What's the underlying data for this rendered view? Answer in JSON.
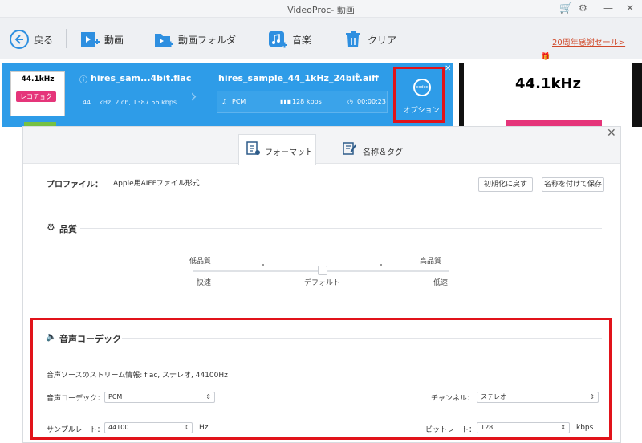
{
  "window": {
    "title": "VideoProc- 動画"
  },
  "toolbar": {
    "back": "戻る",
    "video": "動画",
    "video_folder": "動画フォルダ",
    "music": "音楽",
    "clear": "クリア",
    "promo": "20周年感謝セール>"
  },
  "item": {
    "thumb_text": "44.1kHz",
    "thumb_bar_text": "レコチョク",
    "src_name": "hires_sam...4bit.flac",
    "src_info": "44.1 kHz, 2 ch, 1387.56 kbps",
    "dst_name": "hires_sample_44_1kHz_24bit.aiff",
    "dst_codec": "PCM",
    "dst_bitrate": "128 kbps",
    "dst_duration": "00:00:23",
    "codec_gear_text": "codec",
    "option_label": "オプション"
  },
  "preview": {
    "text": "44.1kHz"
  },
  "dialog": {
    "tabs": [
      {
        "label": "フォーマット"
      },
      {
        "label": "名称＆タグ"
      }
    ],
    "profile_label": "プロファイル：",
    "profile_value": "Apple用AIFFファイル形式",
    "reset_button": "初期化に戻す",
    "save_as_button": "名称を付けて保存",
    "quality": {
      "title": "品質",
      "low": "低品質",
      "high": "高品質",
      "fast": "快速",
      "default": "デフォルト",
      "slow": "低速"
    },
    "audio": {
      "title": "音声コーデック",
      "source_info": "音声ソースのストリーム情報: flac, ステレオ, 44100Hz",
      "codec_label": "音声コーデック：",
      "codec_value": "PCM",
      "channel_label": "チャンネル：",
      "channel_value": "ステレオ",
      "samplerate_label": "サンプルレート：",
      "samplerate_value": "44100",
      "samplerate_unit": "Hz",
      "bitrate_label": "ビットレート：",
      "bitrate_value": "128",
      "bitrate_unit": "kbps"
    }
  }
}
